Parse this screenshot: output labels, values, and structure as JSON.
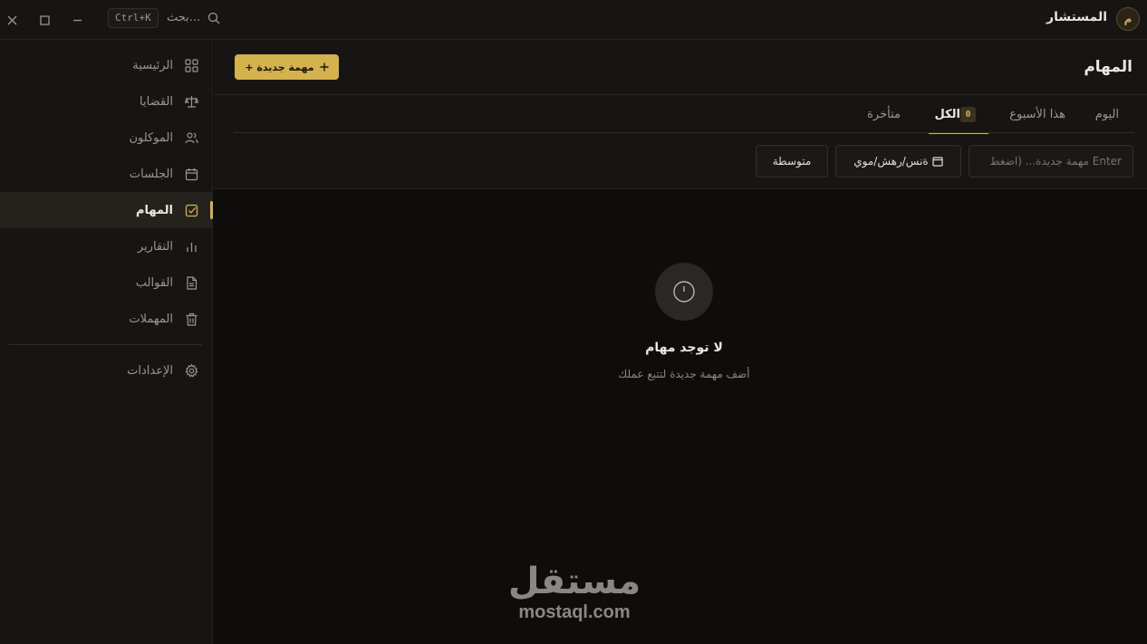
{
  "titlebar": {
    "search_label": "بحث...",
    "shortcut": "Ctrl+K",
    "app_name": "المستشار",
    "avatar_initial": "م"
  },
  "sidebar": {
    "items": [
      {
        "label": "الرئيسية",
        "icon": "grid-icon",
        "active": false
      },
      {
        "label": "القضايا",
        "icon": "scale-icon",
        "active": false
      },
      {
        "label": "الموكلون",
        "icon": "users-icon",
        "active": false
      },
      {
        "label": "الجلسات",
        "icon": "calendar-icon",
        "active": false
      },
      {
        "label": "المهام",
        "icon": "check-square-icon",
        "active": true
      },
      {
        "label": "التقارير",
        "icon": "bar-chart-icon",
        "active": false
      },
      {
        "label": "القوالب",
        "icon": "document-icon",
        "active": false
      },
      {
        "label": "المهملات",
        "icon": "trash-icon",
        "active": false
      }
    ],
    "settings_label": "الإعدادات"
  },
  "main": {
    "title": "المهام",
    "new_task_label": "+ مهمة جديدة",
    "tabs": [
      {
        "label": "اليوم"
      },
      {
        "label": "هذا الأسبوع"
      },
      {
        "label": "الكل",
        "count": "0",
        "active": true
      },
      {
        "label": "متأخرة"
      }
    ],
    "input_placeholder": "مهمة جديدة... (اضغط Enter",
    "date_value": "ةنس/رهش/موي",
    "priority_value": "متوسطة",
    "empty_title": "لا توجد مهام",
    "empty_subtitle": "أضف مهمة جديدة لتتبع عملك"
  },
  "watermark": {
    "arabic": "مستقل",
    "latin": "mostaql.com"
  },
  "colors": {
    "accent": "#d4b24c",
    "background": "#0e0d0c",
    "panel": "#161513"
  }
}
